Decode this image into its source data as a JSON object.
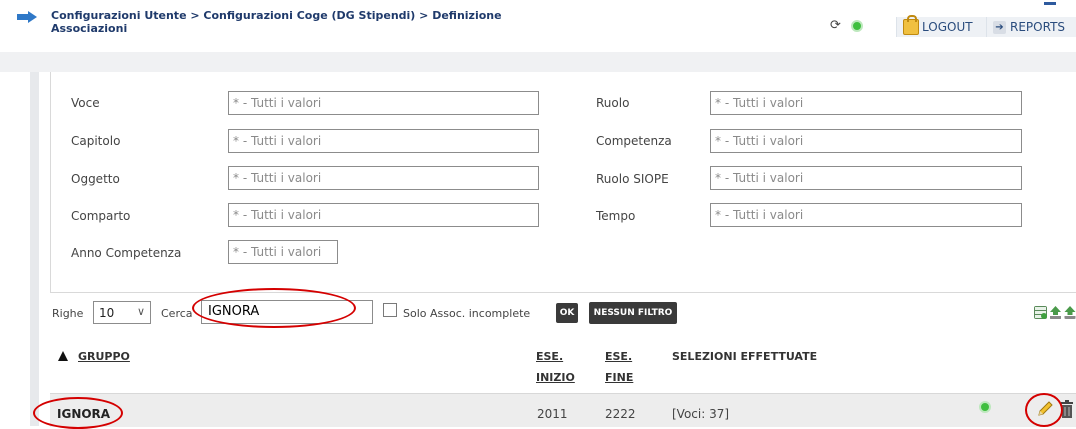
{
  "header": {
    "breadcrumb": "Configurazioni Utente > Configurazioni Coge (DG Stipendi) > Definizione Associazioni",
    "refresh_glyph": "⟳",
    "logout_label": "LOGOUT",
    "reports_label": "REPORTS",
    "reports_glyph": "➔"
  },
  "filters": {
    "voce_label": "Voce",
    "capitolo_label": "Capitolo",
    "oggetto_label": "Oggetto",
    "comparto_label": "Comparto",
    "anno_competenza_label": "Anno Competenza",
    "ruolo_label": "Ruolo",
    "competenza_label": "Competenza",
    "ruolo_siope_label": "Ruolo SIOPE",
    "tempo_label": "Tempo",
    "all_values": "* - Tutti i valori"
  },
  "toolbar": {
    "righe_label": "Righe",
    "righe_value": "10",
    "cerca_label": "Cerca",
    "search_value": "IGNORA",
    "solo_label": "Solo Assoc. incomplete",
    "ok_label": "OK",
    "nessun_filtro_label": "NESSUN FILTRO"
  },
  "table": {
    "col_gruppo": "GRUPPO",
    "col_ese_inizio_1": "ESE.",
    "col_ese_inizio_2": "INIZIO",
    "col_ese_fine_1": "ESE.",
    "col_ese_fine_2": "FINE",
    "col_selezioni": "SELEZIONI EFFETTUATE",
    "rows": [
      {
        "gruppo": "IGNORA",
        "ese_inizio": "2011",
        "ese_fine": "2222",
        "selezioni": "[Voci: 37]"
      }
    ]
  },
  "colors": {
    "accent": "#1f3a6b",
    "status_green": "#3fbf3f",
    "annotation_red": "#d40000",
    "button_dark": "#3a3a3a"
  },
  "icons": [
    "arrow-right-icon",
    "refresh-icon",
    "status-dot-icon",
    "lock-icon",
    "reports-arrow-icon",
    "chevron-down-icon",
    "export-icon",
    "edit-pencil-icon",
    "trash-icon"
  ]
}
